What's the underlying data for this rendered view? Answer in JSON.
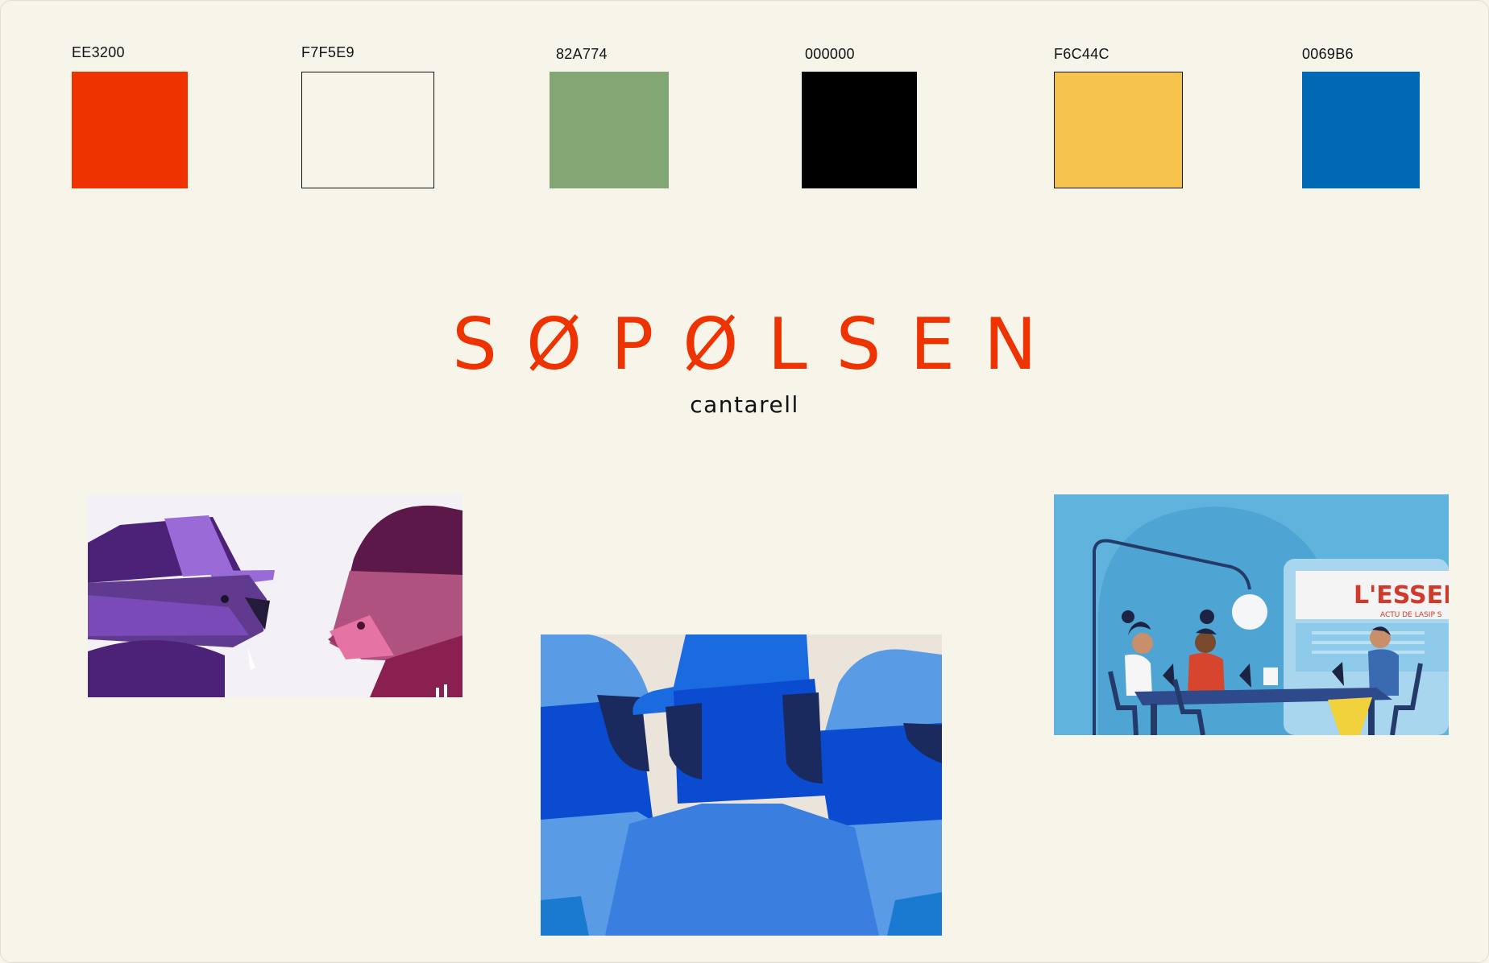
{
  "palette": {
    "swatches": [
      {
        "code": "EE3200",
        "color": "#EE3200"
      },
      {
        "code": "F7F5E9",
        "color": "#F7F5E9"
      },
      {
        "code": "82A774",
        "color": "#82A774"
      },
      {
        "code": "000000",
        "color": "#000000"
      },
      {
        "code": "F6C44C",
        "color": "#F6C44C"
      },
      {
        "code": "0069B6",
        "color": "#0069B6"
      }
    ]
  },
  "brand": {
    "name": "SØPØLSEN",
    "typeface": "cantarell",
    "color": "#EE3200"
  },
  "illustrations": [
    {
      "name": "two-animals-in-caps-illustration"
    },
    {
      "name": "three-figures-in-blue-illustration"
    },
    {
      "name": "meeting-table-illustration",
      "sign_text": "L'ESSENT",
      "sign_subtext": "ACTU DE LASIP S"
    }
  ]
}
